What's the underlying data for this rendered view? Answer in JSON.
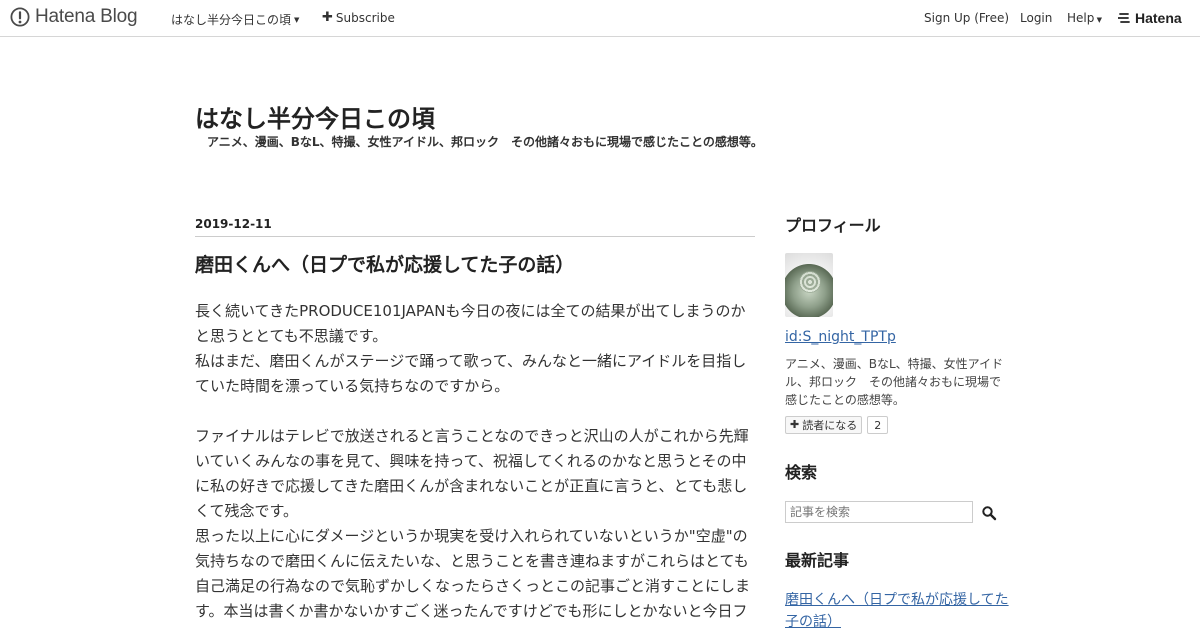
{
  "topbar": {
    "logo_text": "Hatena Blog",
    "blog_menu_label": "はなし半分今日この頃",
    "subscribe_label": "Subscribe",
    "signup_label": "Sign Up (Free)",
    "login_label": "Login",
    "help_label": "Help",
    "brand_label": "Hatena"
  },
  "header": {
    "title": "はなし半分今日この頃",
    "description": "アニメ、漫画、BなL、特撮、女性アイドル、邦ロック　その他諸々おもに現場で感じたことの感想等。"
  },
  "article": {
    "date": "2019-12-11",
    "title": "磨田くんへ（日プで私が応援してた子の話）",
    "paragraphs": [
      "長く続いてきたPRODUCE101JAPANも今日の夜には全ての結果が出てしまうのかと思うととても不思議です。",
      "私はまだ、磨田くんがステージで踊って歌って、みんなと一緒にアイドルを目指していた時間を漂っている気持ちなのですから。",
      "ファイナルはテレビで放送されると言うことなのできっと沢山の人がこれから先輝いていくみんなの事を見て、興味を持って、祝福してくれるのかなと思うとその中に私の好きで応援してきた磨田くんが含まれないことが正直に言うと、とても悲しくて残念です。",
      "思った以上に心にダメージというか現実を受け入れられていないというか\"空虚\"の気持ちなので磨田くんに伝えたいな、と思うことを書き連ねますがこれらはとても自己満足の行為なので気恥ずかしくなったらさくっとこの記事ごと消すことにします。本当は書くか書かないかすごく迷ったんですけどでも形にしとかないと今日フ"
    ]
  },
  "sidebar": {
    "profile_heading": "プロフィール",
    "profile_id": "id:S_night_TPTp",
    "profile_desc": "アニメ、漫画、BなL、特撮、女性アイドル、邦ロック　その他諸々おもに現場で感じたことの感想等。",
    "reader_button": "読者になる",
    "reader_count": "2",
    "search_heading": "検索",
    "search_placeholder": "記事を検索",
    "recent_heading": "最新記事",
    "recent_item": "磨田くんへ（日プで私が応援してた子の話）"
  },
  "colors": {
    "link": "#3465a4",
    "text": "#333333",
    "rule": "#cccccc"
  },
  "icons": [
    "hatena-logo-icon",
    "caret-down-icon",
    "plus-icon",
    "hatena-brand-icon",
    "search-icon"
  ]
}
